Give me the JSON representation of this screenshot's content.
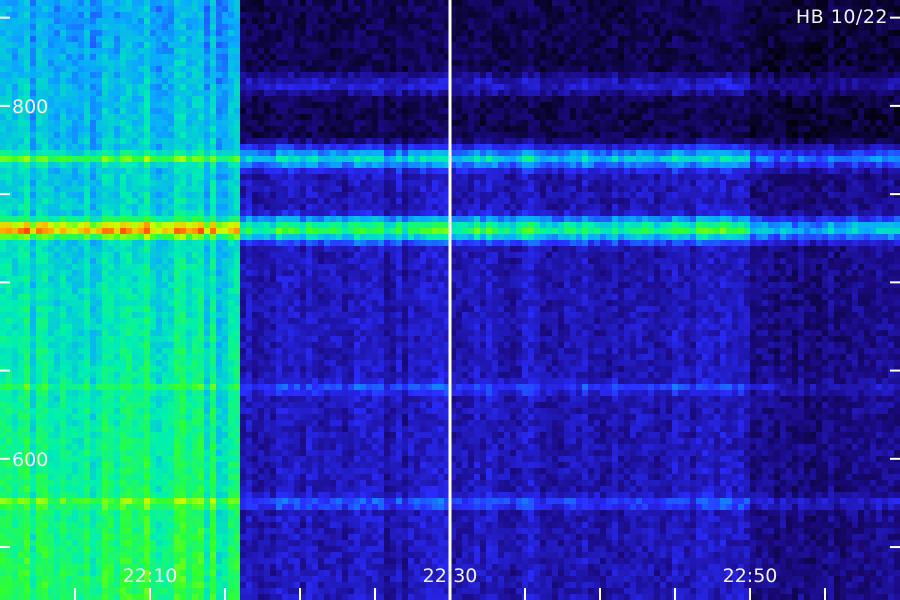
{
  "title": "HB 10/22",
  "chart_data": {
    "type": "heatmap",
    "title": "HB 10/22",
    "xlabel": "",
    "ylabel": "",
    "x_tick_labels": [
      "22:10",
      "22:30",
      "22:50"
    ],
    "y_tick_labels": [
      "800",
      "600"
    ],
    "x_range": [
      "22:00",
      "22:60"
    ],
    "y_range": [
      520,
      860
    ],
    "colormap": [
      "#000000",
      "#1a0a80",
      "#2a2cff",
      "#0aa8ff",
      "#00f0b0",
      "#30ff30",
      "#c8ff00",
      "#ffb000",
      "#ff4000"
    ],
    "marker_time": "22:30",
    "bands": [
      {
        "freq": 812,
        "level_early": 0.45,
        "level_late": 0.22
      },
      {
        "freq": 770,
        "level_early": 0.62,
        "level_late": 0.45
      },
      {
        "freq": 730,
        "level_early": 0.92,
        "level_late": 0.62
      },
      {
        "freq": 640,
        "level_early": 0.6,
        "level_late": 0.28
      },
      {
        "freq": 575,
        "level_early": 0.7,
        "level_late": 0.3
      }
    ],
    "broadband_end_time": "22:16"
  }
}
